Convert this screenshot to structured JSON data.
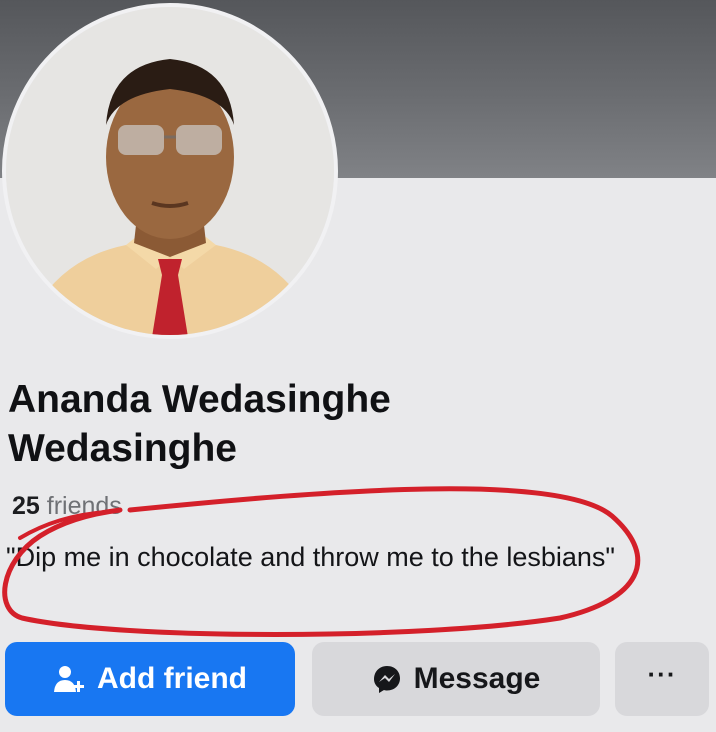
{
  "profile": {
    "name": "Ananda Wedasinghe Wedasinghe",
    "friends_count": "25",
    "friends_label": "friends",
    "bio": "\"Dip me in chocolate and throw me to the lesbians\""
  },
  "actions": {
    "add_friend_label": "Add friend",
    "message_label": "Message",
    "more_label": "···"
  },
  "icons": {
    "add_friend": "add-person-icon",
    "message": "messenger-icon",
    "more": "more-dots-icon"
  },
  "colors": {
    "primary_button": "#1877f2",
    "secondary_button": "#d8d8db",
    "marker_circle": "#d4202a",
    "page_background": "#e9e9eb"
  }
}
